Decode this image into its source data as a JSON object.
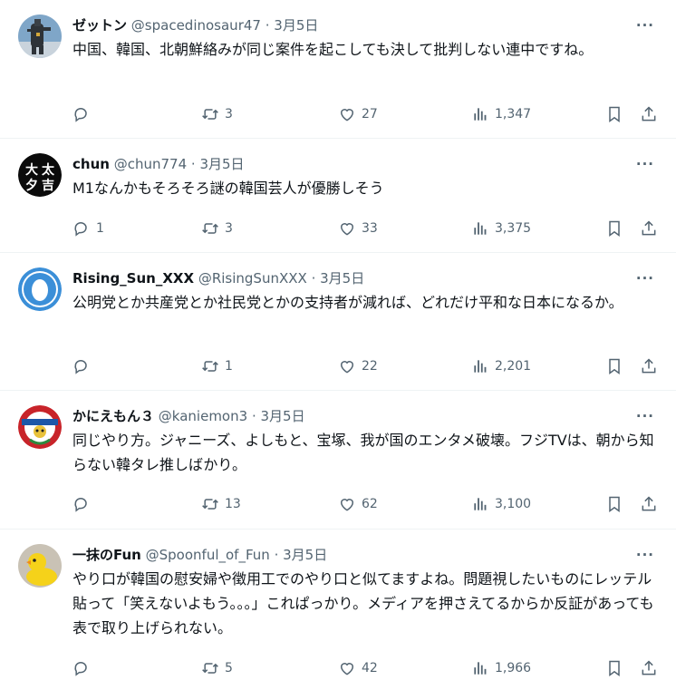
{
  "tweets": [
    {
      "name": "ゼットン",
      "handle": "@spacedinosaur47",
      "sep": "·",
      "date": "3月5日",
      "more": "···",
      "text": "中国、韓国、北朝鮮絡みが同じ案件を起こしても決して批判しない連中ですね。",
      "replies": "",
      "retweets": "3",
      "likes": "27",
      "views": "1,347",
      "avatar": "robot"
    },
    {
      "name": "chun",
      "handle": "@chun774",
      "sep": "·",
      "date": "3月5日",
      "more": "···",
      "text": "M1なんかもそろそろ謎の韓国芸人が優勝しそう",
      "replies": "1",
      "retweets": "3",
      "likes": "33",
      "views": "3,375",
      "avatar": "kanji",
      "avatar_chars": [
        "大",
        "太",
        "夕",
        "吉"
      ]
    },
    {
      "name": "Rising_Sun_XXX",
      "handle": "@RisingSunXXX",
      "sep": "·",
      "date": "3月5日",
      "more": "···",
      "text": "公明党とか共産党とか社民党とかの支持者が減れば、どれだけ平和な日本になるか。",
      "replies": "",
      "retweets": "1",
      "likes": "22",
      "views": "2,201",
      "avatar": "egg"
    },
    {
      "name": "かにえもん３",
      "handle": "@kaniemon3",
      "sep": "·",
      "date": "3月5日",
      "more": "···",
      "text": "同じやり方。ジャニーズ、よしもと、宝塚、我が国のエンタメ破壊。フジTVは、朝から知らない韓タレ推しばかり。",
      "replies": "",
      "retweets": "13",
      "likes": "62",
      "views": "3,100",
      "avatar": "badge"
    },
    {
      "name": "一抹のFun",
      "handle": "@Spoonful_of_Fun",
      "sep": "·",
      "date": "3月5日",
      "more": "···",
      "text": "やり口が韓国の慰安婦や徴用工でのやり口と似てますよね。問題視したいものにレッテル貼って「笑えないよもう。。。」これぱっかり。メディアを押さえてるからか反証があっても表で取り上げられない。",
      "replies": "",
      "retweets": "5",
      "likes": "42",
      "views": "1,966",
      "avatar": "duck"
    }
  ],
  "colors": {
    "text": "#0f1419",
    "muted": "#536471",
    "divider": "#eff3f4",
    "egg_blue": "#3b8fd8"
  }
}
